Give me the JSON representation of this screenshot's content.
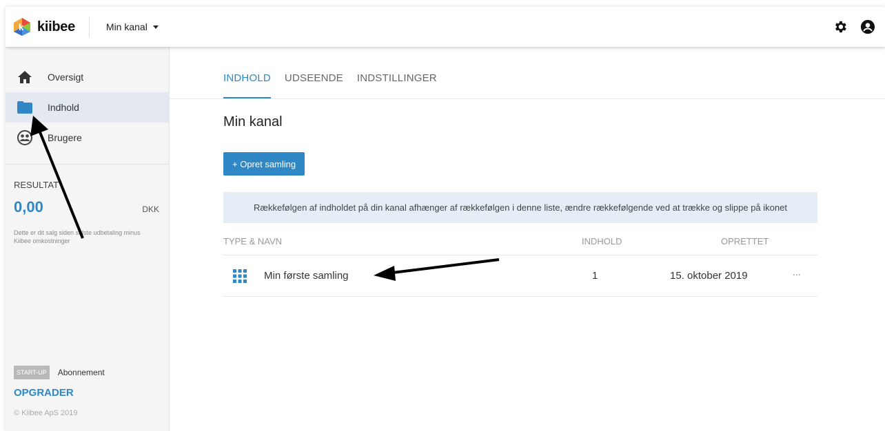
{
  "header": {
    "brand": "kiibee",
    "channel": "Min kanal",
    "icons": [
      "gear-icon",
      "account-icon"
    ]
  },
  "sidebar": {
    "items": [
      {
        "label": "Oversigt",
        "icon": "home-icon"
      },
      {
        "label": "Indhold",
        "icon": "folder-icon",
        "active": true
      },
      {
        "label": "Brugere",
        "icon": "users-icon"
      }
    ],
    "result_label": "RESULTAT",
    "result_value": "0,00",
    "result_currency": "DKK",
    "result_note": "Dette er dit salg siden sidste udbetaling minus Kiibee omkostninger",
    "plan_badge": "START-UP",
    "plan_label": "Abonnement",
    "upgrade": "OPGRADER",
    "copyright": "© Kiibee ApS 2019"
  },
  "tabs": [
    {
      "label": "INDHOLD",
      "active": true
    },
    {
      "label": "UDSEENDE"
    },
    {
      "label": "INDSTILLINGER"
    }
  ],
  "main": {
    "title": "Min kanal",
    "create_button": "+ Opret samling",
    "info": "Rækkefølgen af indholdet på din kanal afhænger af rækkefølgen i denne liste, ændre rækkefølgende ved at trække og slippe på ikonet",
    "table": {
      "headers": [
        "TYPE & NAVN",
        "INDHOLD",
        "OPRETTET"
      ],
      "rows": [
        {
          "icon": "grid-icon",
          "name": "Min første samling",
          "count": "1",
          "created": "15. oktober 2019",
          "more": "..."
        }
      ]
    }
  },
  "colors": {
    "accent": "#2f87c6",
    "active_nav": "#e4e9f1",
    "info_bg": "#e5eef6"
  }
}
